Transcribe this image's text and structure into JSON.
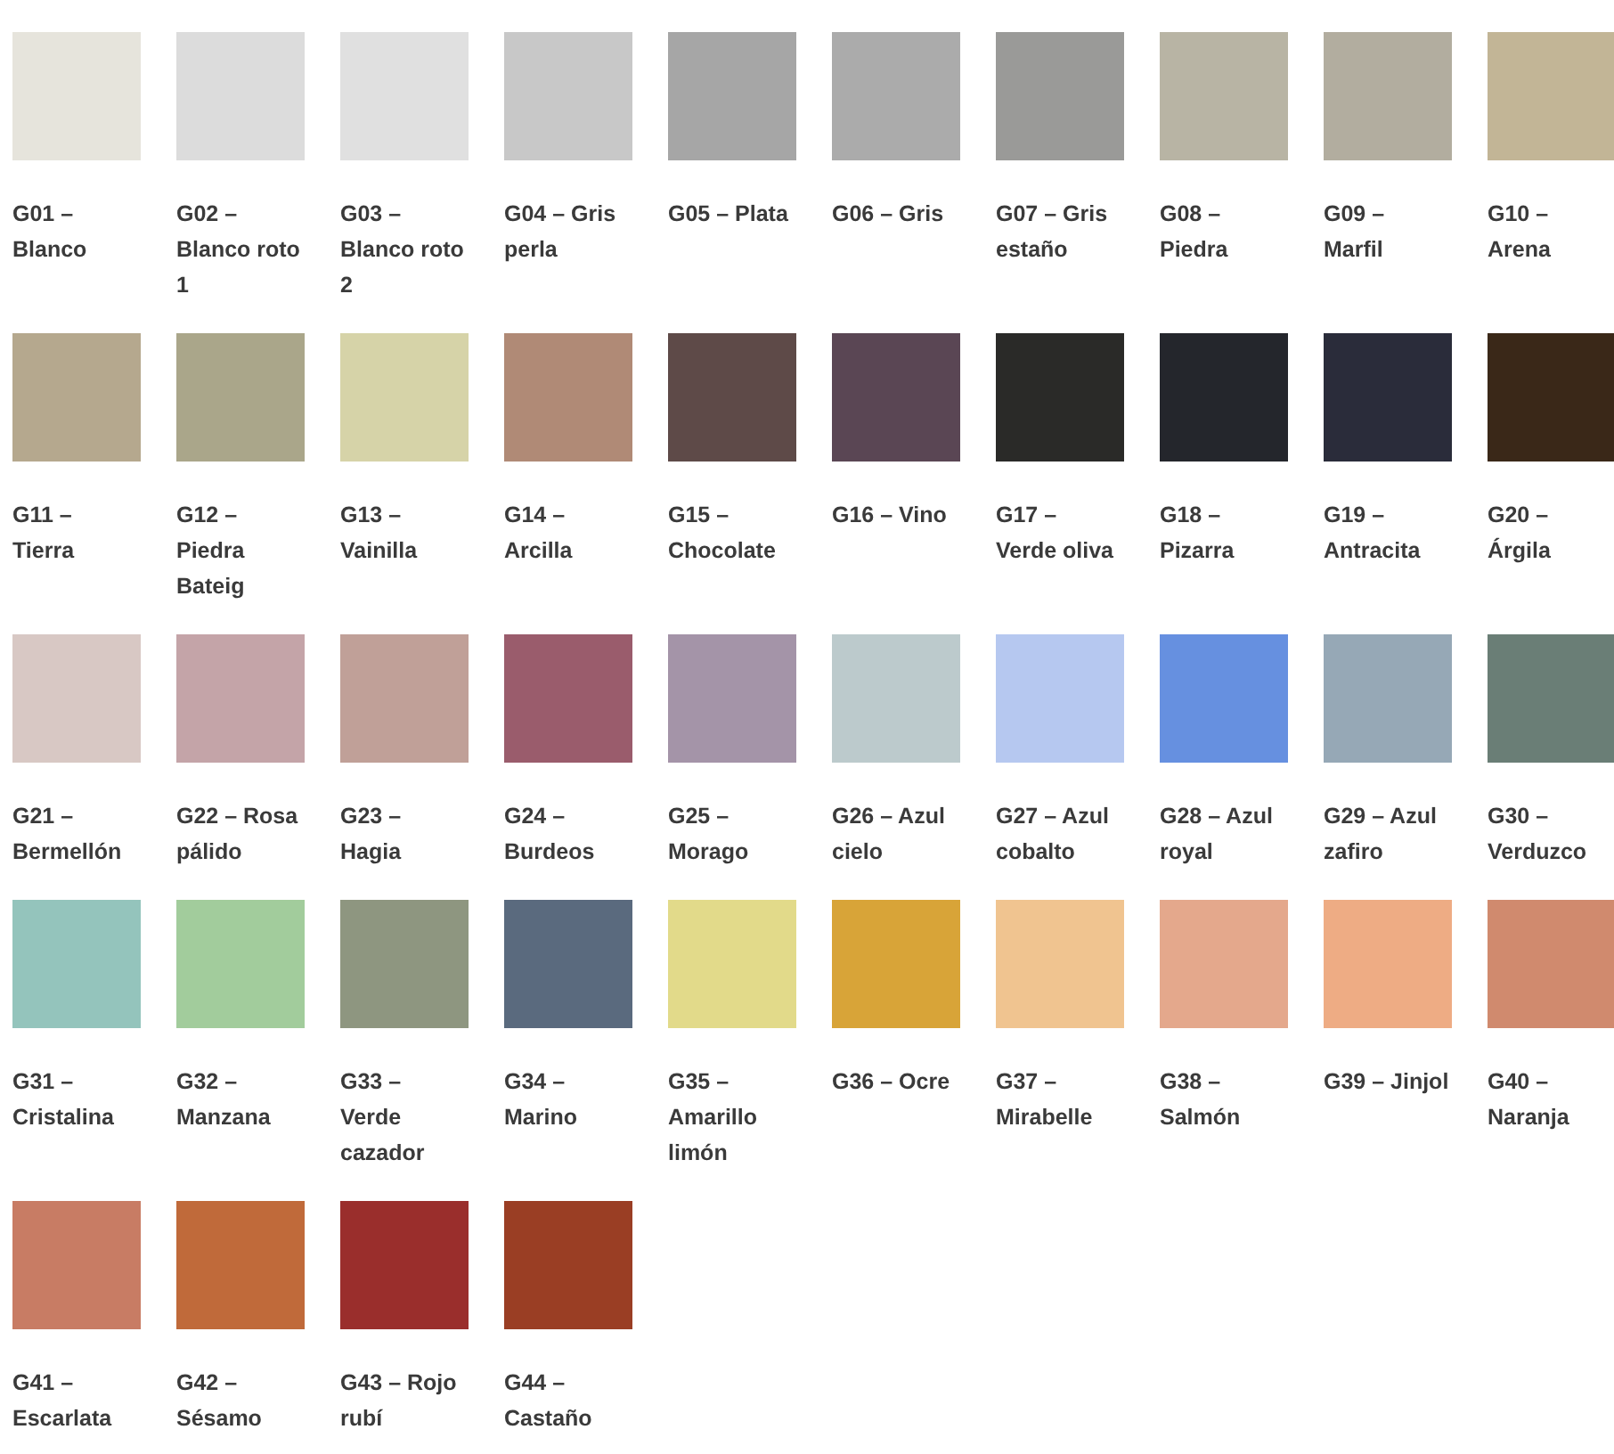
{
  "swatches": [
    {
      "label": "G01 – Blanco",
      "color": "#e6e4dc"
    },
    {
      "label": "G02 – Blanco roto 1",
      "color": "#dcdcdc"
    },
    {
      "label": "G03 – Blanco roto 2",
      "color": "#e0e0e0"
    },
    {
      "label": "G04 – Gris perla",
      "color": "#c8c8c8"
    },
    {
      "label": "G05 – Plata",
      "color": "#a6a6a6"
    },
    {
      "label": "G06 – Gris",
      "color": "#ababab"
    },
    {
      "label": "G07 – Gris estaño",
      "color": "#9a9a98"
    },
    {
      "label": "G08 – Piedra",
      "color": "#b8b4a4"
    },
    {
      "label": "G09 – Marfil",
      "color": "#b2ad9f"
    },
    {
      "label": "G10 – Arena",
      "color": "#c2b596"
    },
    {
      "label": "G11 – Tierra",
      "color": "#b5a88e"
    },
    {
      "label": "G12 – Piedra Bateig",
      "color": "#aaa68a"
    },
    {
      "label": "G13 – Vainilla",
      "color": "#d6d3a8"
    },
    {
      "label": "G14 – Arcilla",
      "color": "#b08a76"
    },
    {
      "label": "G15 – Chocolate",
      "color": "#5e4a48"
    },
    {
      "label": "G16 – Vino",
      "color": "#5a4654"
    },
    {
      "label": "G17 – Verde oliva",
      "color": "#2a2a28"
    },
    {
      "label": "G18 – Pizarra",
      "color": "#24262c"
    },
    {
      "label": "G19 – Antracita",
      "color": "#2a2c3a"
    },
    {
      "label": "G20 – Árgila",
      "color": "#3a2818"
    },
    {
      "label": "G21 – Bermellón",
      "color": "#d8c8c4"
    },
    {
      "label": "G22 – Rosa pálido",
      "color": "#c4a4a8"
    },
    {
      "label": "G23 – Hagia",
      "color": "#c0a098"
    },
    {
      "label": "G24 – Burdeos",
      "color": "#9a5c6c"
    },
    {
      "label": "G25 – Morago",
      "color": "#a494a8"
    },
    {
      "label": "G26 – Azul cielo",
      "color": "#bccacc"
    },
    {
      "label": "G27 – Azul cobalto",
      "color": "#b6c8f0"
    },
    {
      "label": "G28 – Azul royal",
      "color": "#6690e0"
    },
    {
      "label": "G29 – Azul zafiro",
      "color": "#96a8b6"
    },
    {
      "label": "G30 – Verduzco",
      "color": "#6a7e76"
    },
    {
      "label": "G31 – Cristalina",
      "color": "#94c4bc"
    },
    {
      "label": "G32 – Manzana",
      "color": "#a2cc9c"
    },
    {
      "label": "G33 – Verde cazador",
      "color": "#8e9680"
    },
    {
      "label": "G34 – Marino",
      "color": "#5a6a7e"
    },
    {
      "label": "G35 – Amarillo limón",
      "color": "#e2da8a"
    },
    {
      "label": "G36 – Ocre",
      "color": "#d8a438"
    },
    {
      "label": "G37 – Mirabelle",
      "color": "#f0c490"
    },
    {
      "label": "G38 – Salmón",
      "color": "#e4a88c"
    },
    {
      "label": "G39 – Jinjol",
      "color": "#eeac84"
    },
    {
      "label": "G40 – Naranja",
      "color": "#d08a6e"
    },
    {
      "label": "G41 – Escarlata",
      "color": "#c87c64"
    },
    {
      "label": "G42 – Sésamo",
      "color": "#c06a3a"
    },
    {
      "label": "G43 – Rojo rubí",
      "color": "#9a2e2c"
    },
    {
      "label": "G44 – Castaño",
      "color": "#9a3e24"
    }
  ]
}
